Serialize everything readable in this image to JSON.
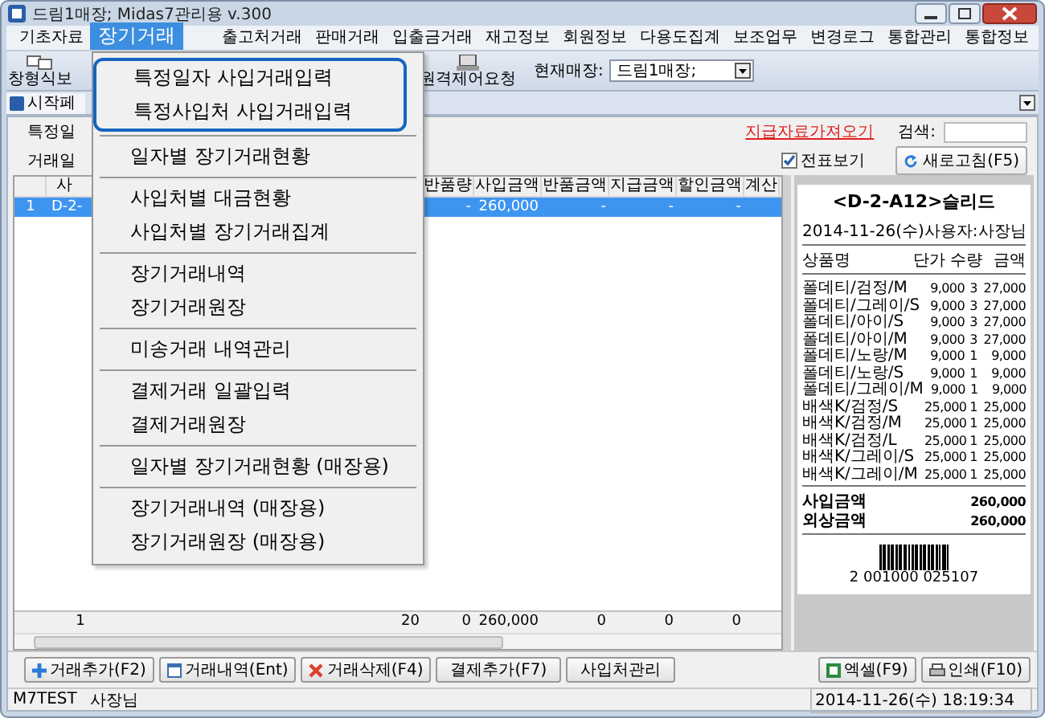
{
  "window": {
    "title": "드림1매장; Midas7관리용 v.300"
  },
  "menu_bar": [
    {
      "label": "기초자료",
      "selected": false
    },
    {
      "label": "장기거래",
      "selected": true
    },
    {
      "label": "출고처거래",
      "selected": false
    },
    {
      "label": "판매거래",
      "selected": false
    },
    {
      "label": "입출금거래",
      "selected": false
    },
    {
      "label": "재고정보",
      "selected": false
    },
    {
      "label": "회원정보",
      "selected": false
    },
    {
      "label": "다용도집계",
      "selected": false
    },
    {
      "label": "보조업무",
      "selected": false
    },
    {
      "label": "변경로그",
      "selected": false
    },
    {
      "label": "통합관리",
      "selected": false
    },
    {
      "label": "통합정보",
      "selected": false
    }
  ],
  "dropdown": {
    "groups": [
      {
        "highlighted": true,
        "items": [
          "특정일자 사입거래입력",
          "특정사입처 사입거래입력"
        ]
      },
      {
        "highlighted": false,
        "items": [
          "일자별 장기거래현황"
        ]
      },
      {
        "highlighted": false,
        "items": [
          "사입처별 대금현황",
          "사입처별 장기거래집계"
        ]
      },
      {
        "highlighted": false,
        "items": [
          "장기거래내역",
          "장기거래원장"
        ]
      },
      {
        "highlighted": false,
        "items": [
          "미송거래 내역관리"
        ]
      },
      {
        "highlighted": false,
        "items": [
          "결제거래 일괄입력",
          "결제거래원장"
        ]
      },
      {
        "highlighted": false,
        "items": [
          "일자별 장기거래현황 (매장용)"
        ]
      },
      {
        "highlighted": false,
        "items": [
          "장기거래내역 (매장용)",
          "장기거래원장 (매장용)"
        ]
      }
    ]
  },
  "toolbar": {
    "view_button": "창형식보",
    "remote_button": "원격제어요청",
    "store_label": "현재매장:",
    "store_value": "드림1매장;"
  },
  "tab": {
    "label": "시작페"
  },
  "filters": {
    "labels": [
      "특정일",
      "거래일"
    ],
    "link": "지급자료가져오기",
    "search_label": "검색:",
    "slip_view": {
      "label": "전표보기",
      "checked": true
    },
    "refresh": "새로고침(F5)"
  },
  "grid": {
    "columns": [
      "",
      "사",
      "반품량",
      "사입금액",
      "반품금액",
      "지급금액",
      "할인금액",
      "계산"
    ],
    "rows": [
      {
        "selected": true,
        "cells": [
          "1",
          "D-2-",
          "-",
          "260,000",
          "-",
          "-",
          "-"
        ]
      }
    ],
    "footer": [
      "1",
      "20",
      "0",
      "260,000",
      "0",
      "0",
      "0"
    ]
  },
  "receipt": {
    "title": "<D-2-A12>슬리드",
    "date": "2014-11-26(수)",
    "user": "사용자:사장님",
    "headers": [
      "상품명",
      "단가",
      "수량",
      "금액"
    ],
    "rows": [
      [
        "폴데티/검정/M",
        "9,000",
        "3",
        "27,000"
      ],
      [
        "폴데티/그레이/S",
        "9,000",
        "3",
        "27,000"
      ],
      [
        "폴데티/아이/S",
        "9,000",
        "3",
        "27,000"
      ],
      [
        "폴데티/아이/M",
        "9,000",
        "3",
        "27,000"
      ],
      [
        "폴데티/노랑/M",
        "9,000",
        "1",
        "9,000"
      ],
      [
        "폴데티/노랑/S",
        "9,000",
        "1",
        "9,000"
      ],
      [
        "폴데티/그레이/M",
        "9,000",
        "1",
        "9,000"
      ],
      [
        "배색K/검정/S",
        "25,000",
        "1",
        "25,000"
      ],
      [
        "배색K/검정/M",
        "25,000",
        "1",
        "25,000"
      ],
      [
        "배색K/검정/L",
        "25,000",
        "1",
        "25,000"
      ],
      [
        "배색K/그레이/S",
        "25,000",
        "1",
        "25,000"
      ],
      [
        "배색K/그레이/M",
        "25,000",
        "1",
        "25,000"
      ]
    ],
    "totals": [
      [
        "사입금액",
        "260,000"
      ],
      [
        "외상금액",
        "260,000"
      ]
    ],
    "barcode": "2 001000 025107"
  },
  "actions": [
    {
      "kind": "plus",
      "label": "거래추가(F2)"
    },
    {
      "kind": "window",
      "label": "거래내역(Ent)"
    },
    {
      "kind": "cross",
      "label": "거래삭제(F4)"
    },
    {
      "kind": "plain",
      "label": "결제추가(F7)"
    },
    {
      "kind": "plain",
      "label": "사입처관리"
    }
  ],
  "exports": [
    {
      "kind": "sheet",
      "label": "엑셀(F9)"
    },
    {
      "kind": "printer",
      "label": "인쇄(F10)"
    }
  ],
  "status_bar": {
    "left": [
      "M7TEST",
      "사장님"
    ],
    "right": "2014-11-26(수) 18:19:34"
  }
}
